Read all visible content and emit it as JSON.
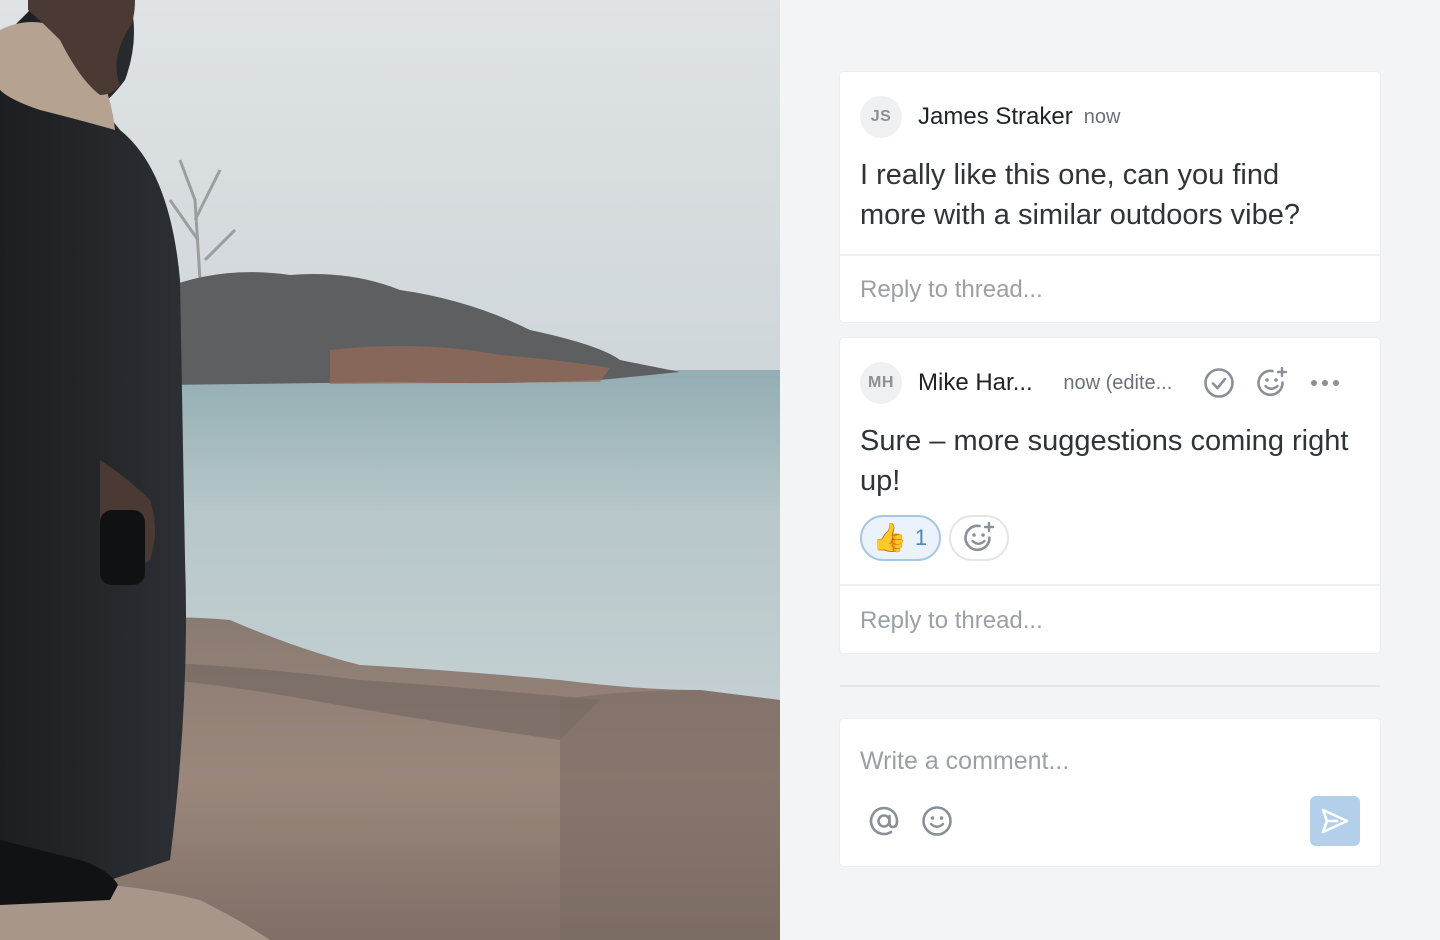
{
  "photo": {
    "description_icon": "photo-image"
  },
  "threads": [
    {
      "avatar_initials": "JS",
      "author": "James Straker",
      "timestamp": "now",
      "body": "I really like this one, can you find more with a similar outdoors vibe?",
      "reply_placeholder": "Reply to thread..."
    },
    {
      "avatar_initials": "MH",
      "author": "Mike Har...",
      "timestamp": "now (edite...",
      "body": "Sure – more suggestions coming right up!",
      "reactions": [
        {
          "emoji": "👍",
          "count": "1"
        }
      ],
      "reply_placeholder": "Reply to thread...",
      "actions": [
        "resolve-icon",
        "add-reaction-icon",
        "more-icon"
      ]
    }
  ],
  "composer": {
    "placeholder": "Write a comment...",
    "tools": [
      "mention-icon",
      "emoji-icon"
    ],
    "send_icon": "send-icon"
  },
  "colors": {
    "background": "#f3f4f6",
    "card": "#ffffff",
    "accent": "#4a86c0",
    "send_button": "#b3cfe9"
  }
}
